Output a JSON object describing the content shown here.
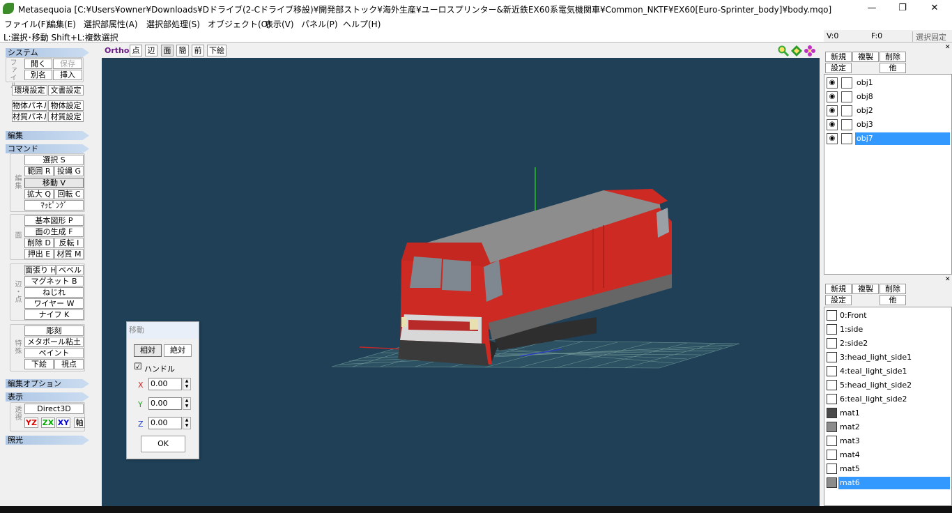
{
  "window": {
    "title": "Metasequoia [C:¥Users¥owner¥Downloads¥Dドライブ(2-Cドライブ移設)¥開発部ストック¥海外生産¥ユーロスプリンター&新近鉄EX60系電気機関車¥Common_NKTF¥EX60[Euro-Sprinter_body]¥body.mqo]",
    "minimize": "—",
    "maximize": "❐",
    "close": "✕"
  },
  "menu": [
    "ファイル(F)",
    "編集(E)",
    "選択部属性(A)",
    "選択部処理(S)",
    "オブジェクト(O)",
    "表示(V)",
    "パネル(P)",
    "ヘルプ(H)"
  ],
  "hint": "L:選択･移動  Shift+L:複数選択",
  "status": {
    "v": "V:0",
    "f": "F:0",
    "fix": "選択固定"
  },
  "left": {
    "system_header": "システム",
    "file_label": "ファイル",
    "open": "開く",
    "save": "保存",
    "save_as": "別名",
    "insert": "挿入",
    "env": "環境設定",
    "doc": "文書設定",
    "obj_panel": "物体パネル",
    "obj_settings": "物体設定",
    "mat_panel": "材質パネル",
    "mat_settings": "材質設定",
    "edit_header": "編集",
    "command_header": "コマンド",
    "edit_label": "編集",
    "select": "選択 S",
    "range": "範囲 R",
    "lasso": "投縄 G",
    "move": "移動 V",
    "scale": "拡大 Q",
    "rotate": "回転 C",
    "mapping": "ﾏｯﾋﾟﾝｸﾞ",
    "face_label": "面",
    "primitive": "基本図形 P",
    "create_face": "面の生成 F",
    "delete": "削除 D",
    "flip": "反転 I",
    "extrude": "押出 E",
    "material": "材質 M",
    "edge_label": "辺・点",
    "stretch": "面張り H",
    "bevel": "ベベル",
    "magnet": "マグネット B",
    "twist": "ねじれ",
    "wire": "ワイヤー W",
    "knife": "ナイフ K",
    "special_label": "特殊",
    "sculpt": "彫刻",
    "metaball": "メタボール粘土",
    "paint": "ペイント",
    "sketch": "下絵",
    "viewpoint": "視点",
    "editopt_header": "編集オプション",
    "display_header": "表示",
    "direct3d": "Direct3D",
    "persp_label": "透視",
    "yz": "YZ",
    "zx": "ZX",
    "xy": "XY",
    "axis": "軸",
    "light_header": "照光"
  },
  "viewport_toolbar": {
    "ortho": "Ortho",
    "point": "点",
    "edge": "辺",
    "face": "面",
    "simple": "簡",
    "front": "前",
    "sketch": "下絵"
  },
  "move_dialog": {
    "title": "移動",
    "relative": "相対",
    "absolute": "絶対",
    "handle_check": "☑",
    "handle": "ハンドル",
    "x_label": "X",
    "x": "0.00",
    "y_label": "Y",
    "y": "0.00",
    "z_label": "Z",
    "z": "0.00",
    "ok": "OK"
  },
  "objects_panel": {
    "new": "新規",
    "dup": "複製",
    "del": "削除",
    "settings": "設定",
    "other": "他",
    "items": [
      {
        "name": "obj1",
        "selected": false
      },
      {
        "name": "obj8",
        "selected": false
      },
      {
        "name": "obj2",
        "selected": false
      },
      {
        "name": "obj3",
        "selected": false
      },
      {
        "name": "obj7",
        "selected": true
      }
    ]
  },
  "materials_panel": {
    "new": "新規",
    "dup": "複製",
    "del": "削除",
    "settings": "設定",
    "other": "他",
    "items": [
      {
        "name": "0:Front",
        "color": "#ffffff",
        "selected": false
      },
      {
        "name": "1:side",
        "color": "#ffffff",
        "selected": false
      },
      {
        "name": "2:side2",
        "color": "#ffffff",
        "selected": false
      },
      {
        "name": "3:head_light_side1",
        "color": "#ffffff",
        "selected": false
      },
      {
        "name": "4:teal_light_side1",
        "color": "#ffffff",
        "selected": false
      },
      {
        "name": "5:head_light_side2",
        "color": "#ffffff",
        "selected": false
      },
      {
        "name": "6:teal_light_side2",
        "color": "#ffffff",
        "selected": false
      },
      {
        "name": "mat1",
        "color": "#4a4a4a",
        "selected": false
      },
      {
        "name": "mat2",
        "color": "#8c8c8c",
        "selected": false
      },
      {
        "name": "mat3",
        "color": "#ffffff",
        "selected": false
      },
      {
        "name": "mat4",
        "color": "#ffffff",
        "selected": false
      },
      {
        "name": "mat5",
        "color": "#ffffff",
        "selected": false
      },
      {
        "name": "mat6",
        "color": "#8c8c8c",
        "selected": true
      }
    ]
  },
  "colors": {
    "viewport": "#1f4057",
    "selection": "#3399ff",
    "locomotive": "#cc2a22",
    "roof": "#8d8d8d"
  }
}
